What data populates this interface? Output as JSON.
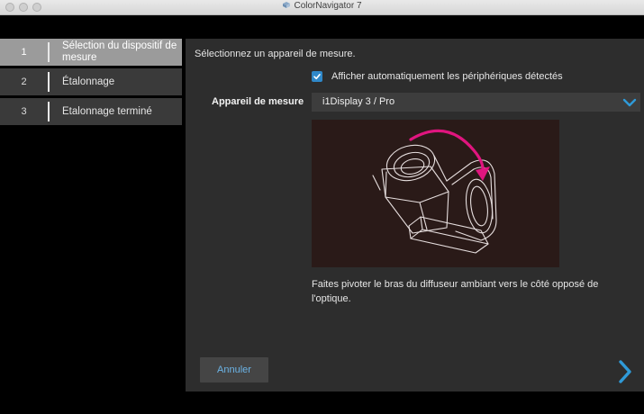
{
  "window": {
    "title": "ColorNavigator 7"
  },
  "steps": [
    {
      "number": "1",
      "label": "Sélection du dispositif de mesure",
      "active": true
    },
    {
      "number": "2",
      "label": "Étalonnage",
      "active": false
    },
    {
      "number": "3",
      "label": "Etalonnage terminé",
      "active": false
    }
  ],
  "main": {
    "prompt": "Sélectionnez un appareil de mesure.",
    "auto_detect": {
      "label": "Afficher automatiquement les périphériques détectés",
      "checked": true
    },
    "device": {
      "label": "Appareil de mesure",
      "selected": "i1Display 3 / Pro"
    },
    "illustration_icon": "colorimeter-rotate-illustration",
    "instruction": "Faites pivoter le bras du diffuseur ambiant vers le côté opposé de l'optique."
  },
  "footer": {
    "cancel_label": "Annuler",
    "next_icon": "chevron-right-icon"
  },
  "colors": {
    "accent": "#2f88c9",
    "arrow": "#e0157f",
    "panel_bg": "#2d2d2d",
    "active_step_bg": "#9b9b9b"
  }
}
